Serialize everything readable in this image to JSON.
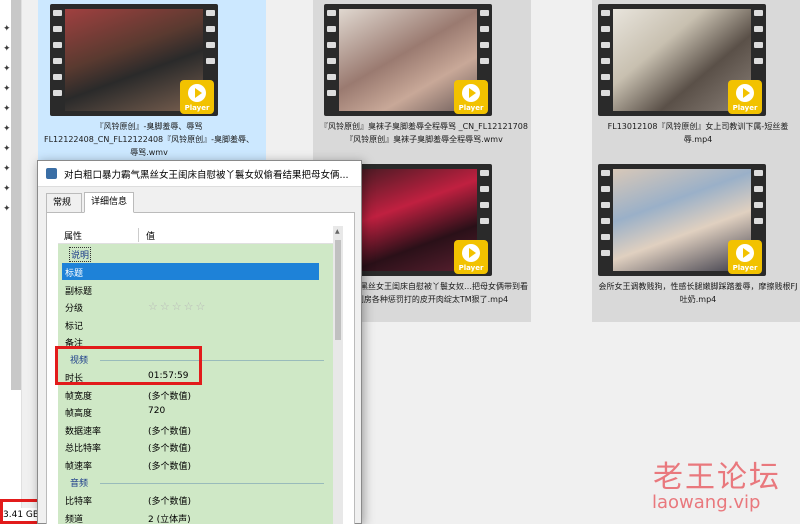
{
  "status_bar": {
    "selection_size": "3.41 GB"
  },
  "tiles": [
    {
      "caption": "『风铃原创』-臭脚羞辱、辱骂 FL12122408_CN_FL12122408『风铃原创』-臭脚羞辱、辱骂.wmv",
      "player": "Player"
    },
    {
      "caption": "『风铃原创』臭袜子臭脚羞辱全程辱骂 _CN_FL12121708『风铃原创』臭袜子臭脚羞辱全程辱骂.wmv",
      "player": "Player"
    },
    {
      "caption": "FL13012108『风铃原创』女上司教训下属-短丝羞辱.mp4",
      "player": "Player"
    },
    {
      "caption": "…暴力霸气黑丝女王闺床自慰被丫鬟女奴…把母女俩带到看待行刑房各种惩罚打的皮开肉绽太TM狠了.mp4",
      "player": "Player"
    },
    {
      "caption": "会所女王调教贱狗，性感长腿嫩脚踩踏羞辱，摩擦贱根FJ吐奶.mp4",
      "player": "Player"
    }
  ],
  "dialog": {
    "title": "对白粗口暴力霸气黑丝女王闺床自慰被丫鬟女奴偷看结果把母女俩...",
    "tabs": [
      "常规",
      "详细信息"
    ],
    "columns": [
      "属性",
      "值"
    ],
    "sections": {
      "description": "说明",
      "video": "视频",
      "audio": "音频"
    },
    "rows": {
      "title": "标题",
      "subtitle": "副标题",
      "rating": "分级",
      "rating_value": "☆☆☆☆☆",
      "tags": "标记",
      "comments": "备注",
      "length": "时长",
      "length_value": "01:57:59",
      "frame_width": "帧宽度",
      "frame_width_value": "(多个数值)",
      "frame_height": "帧高度",
      "frame_height_value": "720",
      "data_rate": "数据速率",
      "data_rate_value": "(多个数值)",
      "total_bitrate": "总比特率",
      "total_bitrate_value": "(多个数值)",
      "frame_rate": "帧速率",
      "frame_rate_value": "(多个数值)",
      "bitrate": "比特率",
      "bitrate_value": "(多个数值)",
      "channels": "频道",
      "channels_value": "2 (立体声)"
    }
  },
  "watermark": {
    "line1": "老王论坛",
    "line2": "laowang.vip"
  }
}
